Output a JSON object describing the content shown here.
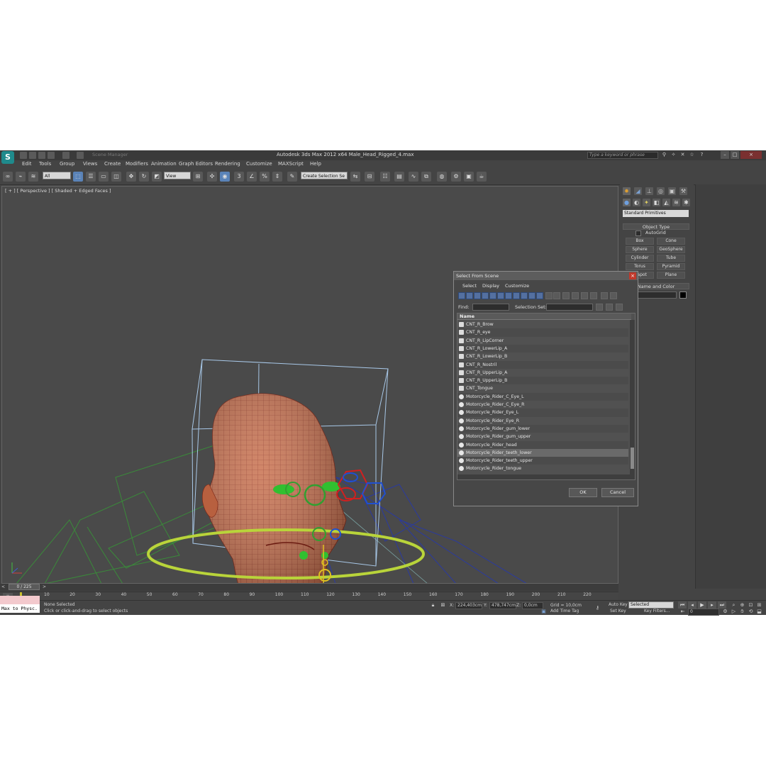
{
  "app": {
    "title": "Autodesk 3ds Max  2012 x64      Male_Head_Rigged_4.max",
    "search_placeholder": "Type a keyword or phrase",
    "logo_letter": "S",
    "workspace_label": "Scene Manager"
  },
  "menubar": [
    "Edit",
    "Tools",
    "Group",
    "Views",
    "Create",
    "Modifiers",
    "Animation",
    "Graph Editors",
    "Rendering",
    "Customize",
    "MAXScript",
    "Help"
  ],
  "toolbar": {
    "selection_filter": "All",
    "ref_coord": "View",
    "named_selection": "Create Selection Se",
    "snap_label": "3"
  },
  "viewport": {
    "label": "[ + ] [ Perspective ] [ Shaded + Edged Faces ]"
  },
  "command_panel": {
    "category": "Standard Primitives",
    "object_type_title": "Object Type",
    "autogrid": "AutoGrid",
    "primitives": [
      "Box",
      "Cone",
      "Sphere",
      "GeoSphere",
      "Cylinder",
      "Tube",
      "Torus",
      "Pyramid",
      "Teapot",
      "Plane"
    ],
    "name_color_title": "Name and Color"
  },
  "dialog": {
    "title": "Select From Scene",
    "menus": [
      "Select",
      "Display",
      "Customize"
    ],
    "find_label": "Find:",
    "selection_set_label": "Selection Set:",
    "column_name": "Name",
    "items": [
      {
        "name": "CNT_R_Brow",
        "kind": "control"
      },
      {
        "name": "CNT_R_eye",
        "kind": "control"
      },
      {
        "name": "CNT_R_LipCorner",
        "kind": "control"
      },
      {
        "name": "CNT_R_LowerLip_A",
        "kind": "control"
      },
      {
        "name": "CNT_R_LowerLip_B",
        "kind": "control"
      },
      {
        "name": "CNT_R_Nostril",
        "kind": "control"
      },
      {
        "name": "CNT_R_UpperLip_A",
        "kind": "control"
      },
      {
        "name": "CNT_R_UpperLip_B",
        "kind": "control"
      },
      {
        "name": "CNT_Tongue",
        "kind": "control"
      },
      {
        "name": "Motorcycle_Rider_C_Eye_L",
        "kind": "geometry"
      },
      {
        "name": "Motorcycle_Rider_C_Eye_R",
        "kind": "geometry"
      },
      {
        "name": "Motorcycle_Rider_Eye_L",
        "kind": "geometry"
      },
      {
        "name": "Motorcycle_Rider_Eye_R",
        "kind": "geometry"
      },
      {
        "name": "Motorcycle_Rider_gum_lower",
        "kind": "geometry"
      },
      {
        "name": "Motorcycle_Rider_gum_upper",
        "kind": "geometry"
      },
      {
        "name": "Motorcycle_Rider_head",
        "kind": "geometry"
      },
      {
        "name": "Motorcycle_Rider_teeth_lower",
        "kind": "geometry",
        "selected": true
      },
      {
        "name": "Motorcycle_Rider_teeth_upper",
        "kind": "geometry"
      },
      {
        "name": "Motorcycle_Rider_tongue",
        "kind": "geometry"
      }
    ],
    "ok_label": "OK",
    "cancel_label": "Cancel"
  },
  "timeline": {
    "frame_label": "0 / 225",
    "ticks": [
      "10",
      "20",
      "30",
      "40",
      "50",
      "60",
      "70",
      "80",
      "90",
      "100",
      "110",
      "120",
      "130",
      "140",
      "150",
      "160",
      "170",
      "180",
      "190",
      "200",
      "210",
      "220"
    ]
  },
  "status": {
    "selection": "None Selected",
    "prompt": "Click or click-and-drag to select objects",
    "listener": "Max to Physc.",
    "x": "224,403cm",
    "y": "478,747cm",
    "z": "0,0cm",
    "x_label": "X:",
    "y_label": "Y:",
    "z_label": "Z:",
    "grid": "Grid = 10,0cm",
    "add_time_tag": "Add Time Tag",
    "auto_key": "Auto Key",
    "set_key": "Set Key",
    "key_mode": "Selected",
    "key_filters": "Key Filters...",
    "current_frame": "0"
  },
  "colors": {
    "head": "#c9714f",
    "wire": "#9a2f1f",
    "ring": "#b9d43a",
    "control_red": "#d02020",
    "control_blue": "#2050d0",
    "control_green": "#20b040",
    "bbox": "#a8c8e8"
  }
}
